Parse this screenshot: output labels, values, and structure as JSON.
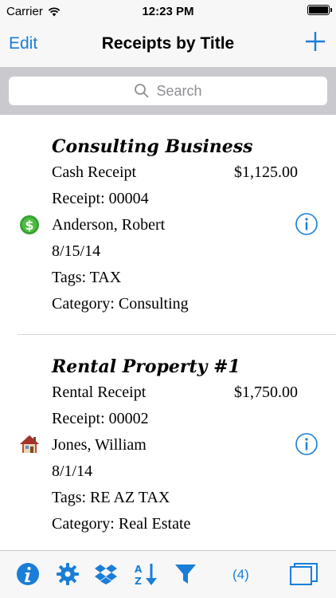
{
  "status": {
    "carrier": "Carrier",
    "time": "12:23 PM"
  },
  "nav": {
    "edit_label": "Edit",
    "title": "Receipts by Title"
  },
  "search": {
    "placeholder": "Search"
  },
  "receipts": [
    {
      "title": "Consulting Business",
      "type": "Cash Receipt",
      "amount": "$1,125.00",
      "number": "Receipt: 00004",
      "payer": "Anderson, Robert",
      "date": "8/15/14",
      "tags": "Tags: TAX",
      "category": "Category: Consulting",
      "icon": "cash-icon"
    },
    {
      "title": "Rental Property #1",
      "type": "Rental Receipt",
      "amount": "$1,750.00",
      "number": "Receipt: 00002",
      "payer": "Jones, William",
      "date": "8/1/14",
      "tags": "Tags: RE AZ TAX",
      "category": "Category: Real Estate",
      "icon": "house-icon"
    }
  ],
  "toolbar": {
    "count": "(4)",
    "icons": [
      "info-icon",
      "gear-icon",
      "dropbox-icon",
      "sort-az-icon",
      "filter-icon",
      "windows-icon"
    ]
  },
  "colors": {
    "accent": "#1a7ed8",
    "bar_bg": "#f7f7f7",
    "search_bg": "#c9c9ce"
  }
}
